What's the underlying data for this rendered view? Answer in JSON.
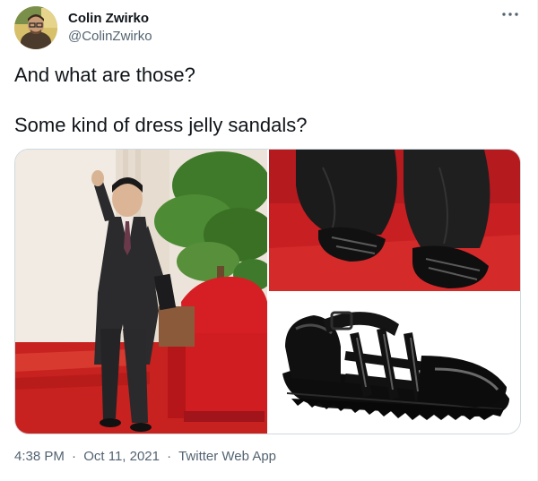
{
  "tweet": {
    "author": {
      "display_name": "Colin Zwirko",
      "handle": "@ColinZwirko"
    },
    "text_lines": [
      "And what are those?",
      "Some kind of dress jelly sandals?"
    ],
    "meta": {
      "time": "4:38 PM",
      "date": "Oct 11, 2021",
      "source": "Twitter Web App",
      "separator": "·"
    },
    "icons": {
      "more": "more-horizontal-icon"
    },
    "colors": {
      "text_primary": "#0f1419",
      "text_secondary": "#536471",
      "border": "#cfd9de"
    }
  }
}
